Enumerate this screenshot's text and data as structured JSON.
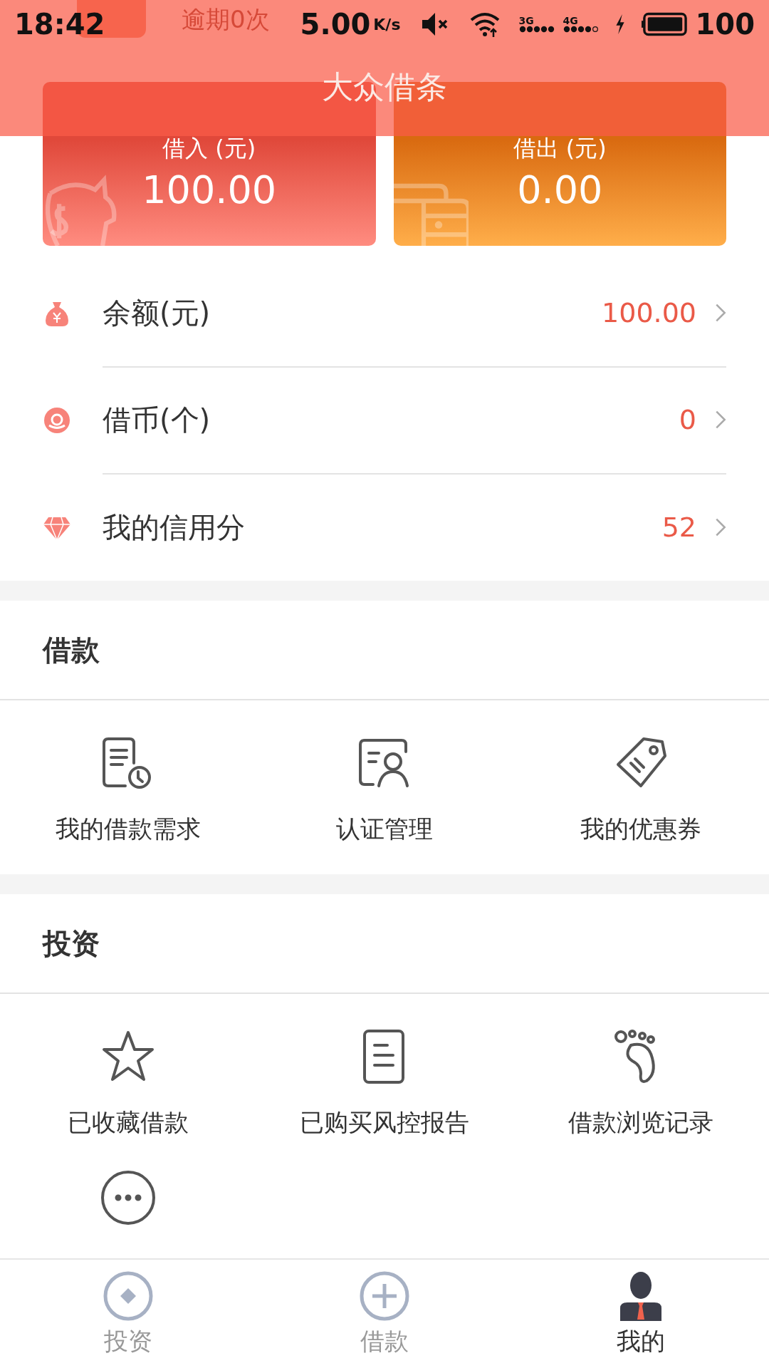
{
  "status_bar": {
    "time": "18:42",
    "speed": "5.00",
    "speed_unit": "K/s",
    "network_1": "3G",
    "network_2": "4G",
    "battery": "100"
  },
  "header": {
    "title": "大众借条"
  },
  "profile": {
    "overdue": "逾期0次"
  },
  "cards": [
    {
      "kind": "borrow",
      "label": "借入 (元)",
      "amount": "100.00"
    },
    {
      "kind": "lend",
      "label": "借出 (元)",
      "amount": "0.00"
    }
  ],
  "accounts": [
    {
      "kind": "balance",
      "label": "余额(元)",
      "value": "100.00"
    },
    {
      "kind": "coin",
      "label": "借币(个)",
      "value": "0"
    },
    {
      "kind": "credit",
      "label": "我的信用分",
      "value": "52"
    }
  ],
  "sections": [
    {
      "title": "借款",
      "items": [
        {
          "kind": "request",
          "label": "我的借款需求"
        },
        {
          "kind": "verify",
          "label": "认证管理"
        },
        {
          "kind": "coupon",
          "label": "我的优惠券"
        }
      ]
    },
    {
      "title": "投资",
      "items": [
        {
          "kind": "favorite",
          "label": "已收藏借款"
        },
        {
          "kind": "report",
          "label": "已购买风控报告"
        },
        {
          "kind": "history",
          "label": "借款浏览记录"
        },
        {
          "kind": "more"
        }
      ]
    }
  ],
  "tab_bar": [
    {
      "kind": "invest",
      "label": "投资",
      "selected": false
    },
    {
      "kind": "loan",
      "label": "借款",
      "selected": false
    },
    {
      "kind": "mine",
      "label": "我的",
      "selected": true
    }
  ]
}
